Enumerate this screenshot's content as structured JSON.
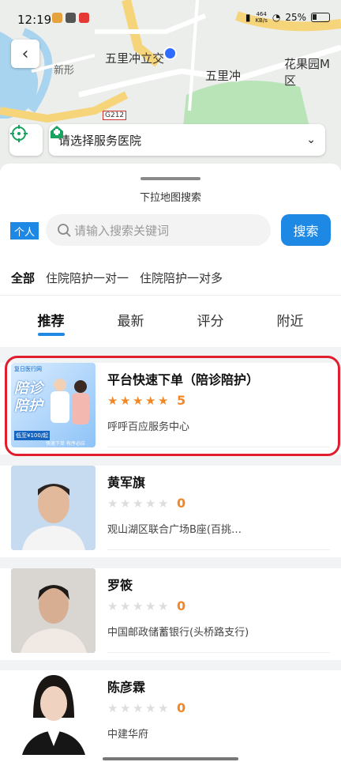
{
  "status_bar": {
    "time": "12:19",
    "net_speed_value": "464",
    "net_speed_unit": "KB/s",
    "battery": "25%"
  },
  "map": {
    "labels": {
      "wulichong_li": "五里冲立交",
      "xinxing": "新形",
      "wulichong": "五里冲",
      "huaguoyuan": "花果园M区",
      "road": "G212"
    },
    "hospital_select_label": "请选择服务医院"
  },
  "sheet": {
    "pull_hint": "下拉地图搜索",
    "scope_tag": "个人",
    "search_placeholder": "请输入搜索关键词",
    "search_button": "搜索",
    "categories": [
      "全部",
      "住院陪护一对一",
      "住院陪护一对多"
    ],
    "tabs": [
      "推荐",
      "最新",
      "评分",
      "附近"
    ]
  },
  "providers": [
    {
      "name": "平台快速下单（陪诊陪护）",
      "stars": 5,
      "rating": "5",
      "address": "呼呼百应服务中心",
      "banner": {
        "top": "复日医行网",
        "title": "陪诊陪护",
        "price": "低至¥100/起",
        "slogan": "快速下单 有序必应"
      }
    },
    {
      "name": "黄军旗",
      "stars": 0,
      "rating": "0",
      "address": "观山湖区联合广场B座(百挑…"
    },
    {
      "name": "罗筱",
      "stars": 0,
      "rating": "0",
      "address": "中国邮政储蓄银行(头桥路支行)"
    },
    {
      "name": "陈彦霖",
      "stars": 0,
      "rating": "0",
      "address": "中建华府"
    }
  ],
  "colors": {
    "accent": "#1e88e5",
    "star": "#f0882a",
    "highlight": "#e01e2d"
  }
}
